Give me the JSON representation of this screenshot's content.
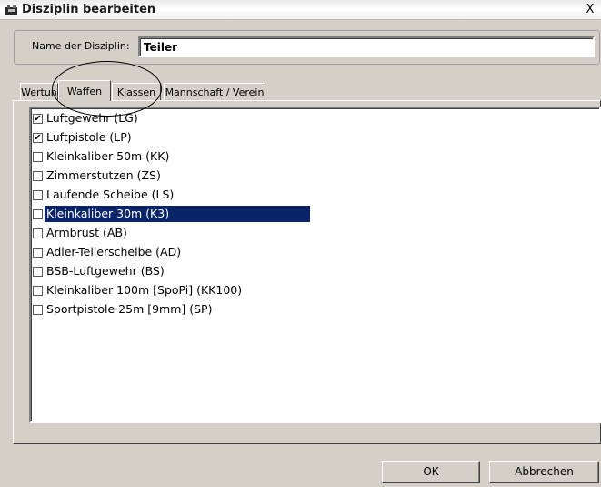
{
  "window": {
    "title": "Disziplin bearbeiten",
    "close_label": "X"
  },
  "name_field": {
    "label": "Name der Disziplin:",
    "value": "Teiler"
  },
  "tabs": [
    {
      "label": "Wertung",
      "active": false
    },
    {
      "label": "Waffen",
      "active": true
    },
    {
      "label": "Klassen",
      "active": false
    },
    {
      "label": "Mannschaft / Verein",
      "active": false
    }
  ],
  "weapons": [
    {
      "label": "Luftgewehr (LG)",
      "checked": true,
      "selected": false
    },
    {
      "label": "Luftpistole (LP)",
      "checked": true,
      "selected": false
    },
    {
      "label": "Kleinkaliber 50m (KK)",
      "checked": false,
      "selected": false
    },
    {
      "label": "Zimmerstutzen (ZS)",
      "checked": false,
      "selected": false
    },
    {
      "label": "Laufende Scheibe (LS)",
      "checked": false,
      "selected": false
    },
    {
      "label": "Kleinkaliber 30m (K3)",
      "checked": false,
      "selected": true
    },
    {
      "label": "Armbrust (AB)",
      "checked": false,
      "selected": false
    },
    {
      "label": "Adler-Teilerscheibe (AD)",
      "checked": false,
      "selected": false
    },
    {
      "label": "BSB-Luftgewehr (BS)",
      "checked": false,
      "selected": false
    },
    {
      "label": "Kleinkaliber 100m [SpoPi] (KK100)",
      "checked": false,
      "selected": false
    },
    {
      "label": "Sportpistole 25m [9mm] (SP)",
      "checked": false,
      "selected": false
    }
  ],
  "buttons": {
    "ok_label": "OK",
    "cancel_label": "Abbrechen"
  },
  "colors": {
    "selection": "#0a246a",
    "face": "#d4d0c8"
  }
}
